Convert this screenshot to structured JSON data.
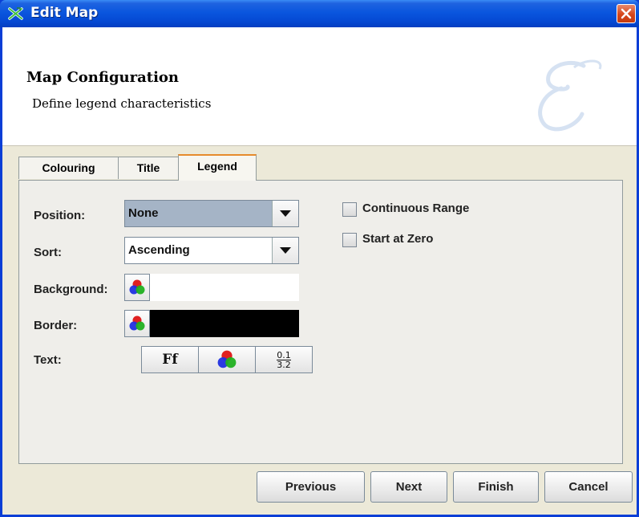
{
  "window": {
    "title": "Edit Map"
  },
  "header": {
    "title": "Map Configuration",
    "subtitle": "Define legend characteristics"
  },
  "tabs": [
    {
      "label": "Colouring",
      "active": false
    },
    {
      "label": "Title",
      "active": false
    },
    {
      "label": "Legend",
      "active": true
    }
  ],
  "form": {
    "position_label": "Position:",
    "position_value": "None",
    "sort_label": "Sort:",
    "sort_value": "Ascending",
    "background_label": "Background:",
    "background_color": "#ffffff",
    "border_label": "Border:",
    "border_color": "#000000",
    "text_label": "Text:",
    "font_button_text": "Ff",
    "format_button_top": "0.1",
    "format_button_bottom": "3.2"
  },
  "options": {
    "continuous_range_label": "Continuous Range",
    "continuous_range_checked": false,
    "start_at_zero_label": "Start at Zero",
    "start_at_zero_checked": false
  },
  "buttons": {
    "previous": "Previous",
    "next": "Next",
    "finish": "Finish",
    "cancel": "Cancel"
  },
  "icons": {
    "app": "map-wizard-icon",
    "close": "close-icon",
    "color_chooser": "rgb-circles-icon",
    "font": "font-icon",
    "number_format": "number-format-icon",
    "watermark": "script-e-watermark"
  },
  "colors": {
    "titlebar": "#0a56de",
    "close_button": "#d6461a",
    "active_tab_accent": "#e68b2c",
    "selected_combo": "#a5b4c6"
  }
}
